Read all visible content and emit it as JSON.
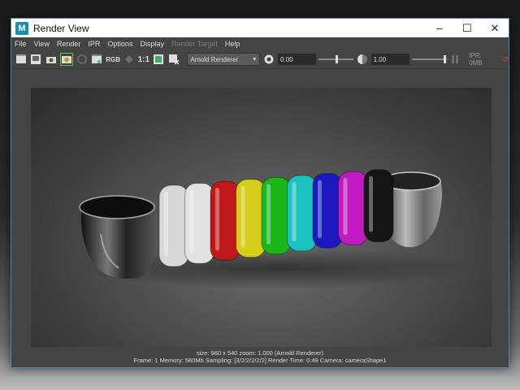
{
  "window": {
    "title": "Render View",
    "app_icon_letter": "M",
    "controls": [
      "minimize",
      "maximize",
      "close"
    ]
  },
  "menu": {
    "items": [
      "File",
      "View",
      "Render",
      "IPR",
      "Options",
      "Display",
      "Render Target",
      "Help"
    ],
    "disabled": [
      "Render Target"
    ]
  },
  "toolbar": {
    "rgb_label": "RGB",
    "one_to_one_label": "1:1",
    "renderer": "Arnold Renderer",
    "exposure_value": "0.00",
    "gamma_value": "1.00",
    "ipr_label": "IPR: 0MB",
    "exposure_slider_level": 0.5,
    "gamma_slider_level": 0.95
  },
  "status": {
    "line1": "size: 960 x 540  zoom: 1.000     (Arnold Renderer)",
    "line2": "Frame: 1     Memory: 560Mb     Sampling: [3/2/2/2/2/2]     Render Time: 0:49     Camera: cameraShape1"
  },
  "scene": {
    "ring_colors": [
      "#d8d8d8",
      "#e2e2e2",
      "#c01818",
      "#d6cc1a",
      "#1cb51c",
      "#1cc1c1",
      "#1a1ac0",
      "#c01ac0",
      "#151515"
    ]
  },
  "colors": {
    "window_border": "#5a7fb0",
    "panel": "#444444",
    "active_outline": "#6abf3a"
  }
}
